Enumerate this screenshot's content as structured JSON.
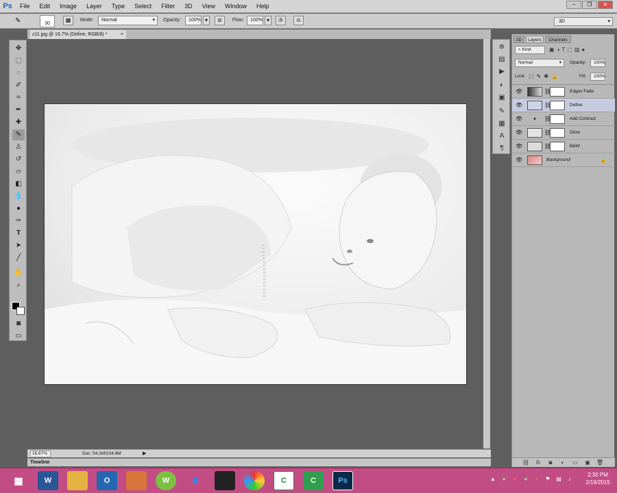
{
  "app": {
    "logo": "Ps"
  },
  "menu": [
    "File",
    "Edit",
    "Image",
    "Layer",
    "Type",
    "Select",
    "Filter",
    "3D",
    "View",
    "Window",
    "Help"
  ],
  "workspace": "3D",
  "window_buttons": [
    "–",
    "❐",
    "✕"
  ],
  "options_bar": {
    "brush_size": "30",
    "mode_label": "Mode:",
    "mode_value": "Normal",
    "opacity_label": "Opacity:",
    "opacity_value": "100%",
    "flow_label": "Flow:",
    "flow_value": "100%"
  },
  "document": {
    "tab_title": "z11.jpg @ 16.7% (Define, RGB/8) *",
    "zoom": "16.67%",
    "doc_info": "Doc: 54.2M/234.8M",
    "timeline_label": "Timeline"
  },
  "layers_panel": {
    "tabs": [
      "3D",
      "Layers",
      "Channels"
    ],
    "active_tab": "Layers",
    "filter_kind": "Kind",
    "blend_mode": "Normal",
    "opacity_label": "Opacity:",
    "opacity_value": "100%",
    "lock_label": "Lock:",
    "fill_label": "Fill:",
    "fill_value": "100%",
    "layers": [
      {
        "name": "Edges Fade",
        "selected": false
      },
      {
        "name": "Define",
        "selected": true
      },
      {
        "name": "Add Contrast",
        "selected": false
      },
      {
        "name": "Glow",
        "selected": false
      },
      {
        "name": "B&W",
        "selected": false
      },
      {
        "name": "Background",
        "selected": false
      }
    ]
  },
  "taskbar": {
    "time": "2:30 PM",
    "date": "2/19/2015",
    "apps": [
      "W",
      "",
      "O",
      "",
      "W",
      "e",
      "",
      "",
      "C",
      "C",
      "Ps"
    ]
  },
  "colors": {
    "taskbar": "#c24d84",
    "selected_layer": "#c6cbe0",
    "ps_blue": "#1c64b4"
  }
}
